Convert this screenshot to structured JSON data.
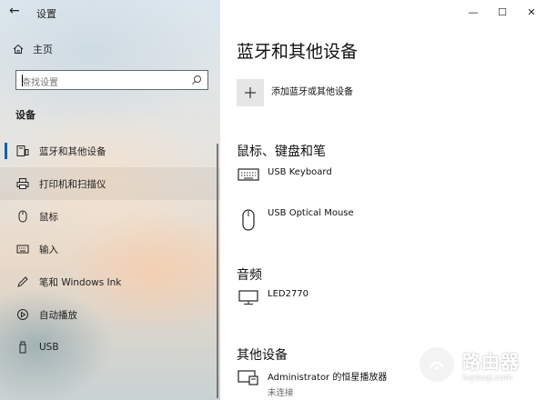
{
  "window": {
    "title": "设置",
    "back_glyph": "←",
    "minimize_glyph": "—",
    "maximize_glyph": "☐",
    "close_glyph": "✕"
  },
  "sidebar": {
    "home_label": "主页",
    "search_placeholder": "查找设置",
    "section_label": "设备",
    "items": [
      {
        "label": "蓝牙和其他设备",
        "icon": "bluetooth-devices-icon",
        "active": true
      },
      {
        "label": "打印机和扫描仪",
        "icon": "printer-icon"
      },
      {
        "label": "鼠标",
        "icon": "mouse-icon"
      },
      {
        "label": "输入",
        "icon": "keyboard-icon"
      },
      {
        "label": "笔和 Windows Ink",
        "icon": "pen-icon"
      },
      {
        "label": "自动播放",
        "icon": "autoplay-icon"
      },
      {
        "label": "USB",
        "icon": "usb-icon"
      }
    ]
  },
  "main": {
    "title": "蓝牙和其他设备",
    "add_device_label": "添加蓝牙或其他设备",
    "sections": [
      {
        "heading": "鼠标、键盘和笔",
        "devices": [
          {
            "name": "USB Keyboard",
            "icon": "keyboard-icon"
          },
          {
            "name": "USB Optical Mouse",
            "icon": "mouse-icon"
          }
        ]
      },
      {
        "heading": "音频",
        "devices": [
          {
            "name": "LED2770",
            "icon": "monitor-icon"
          }
        ]
      },
      {
        "heading": "其他设备",
        "devices": [
          {
            "name": "Administrator 的恒星播放器",
            "status": "未连接",
            "icon": "media-device-icon"
          }
        ]
      }
    ]
  },
  "watermark": {
    "text": "路由器",
    "url": "luyouqi.com"
  },
  "colors": {
    "accent": "#0063b1",
    "add_button_bg": "#e6e6e6"
  }
}
